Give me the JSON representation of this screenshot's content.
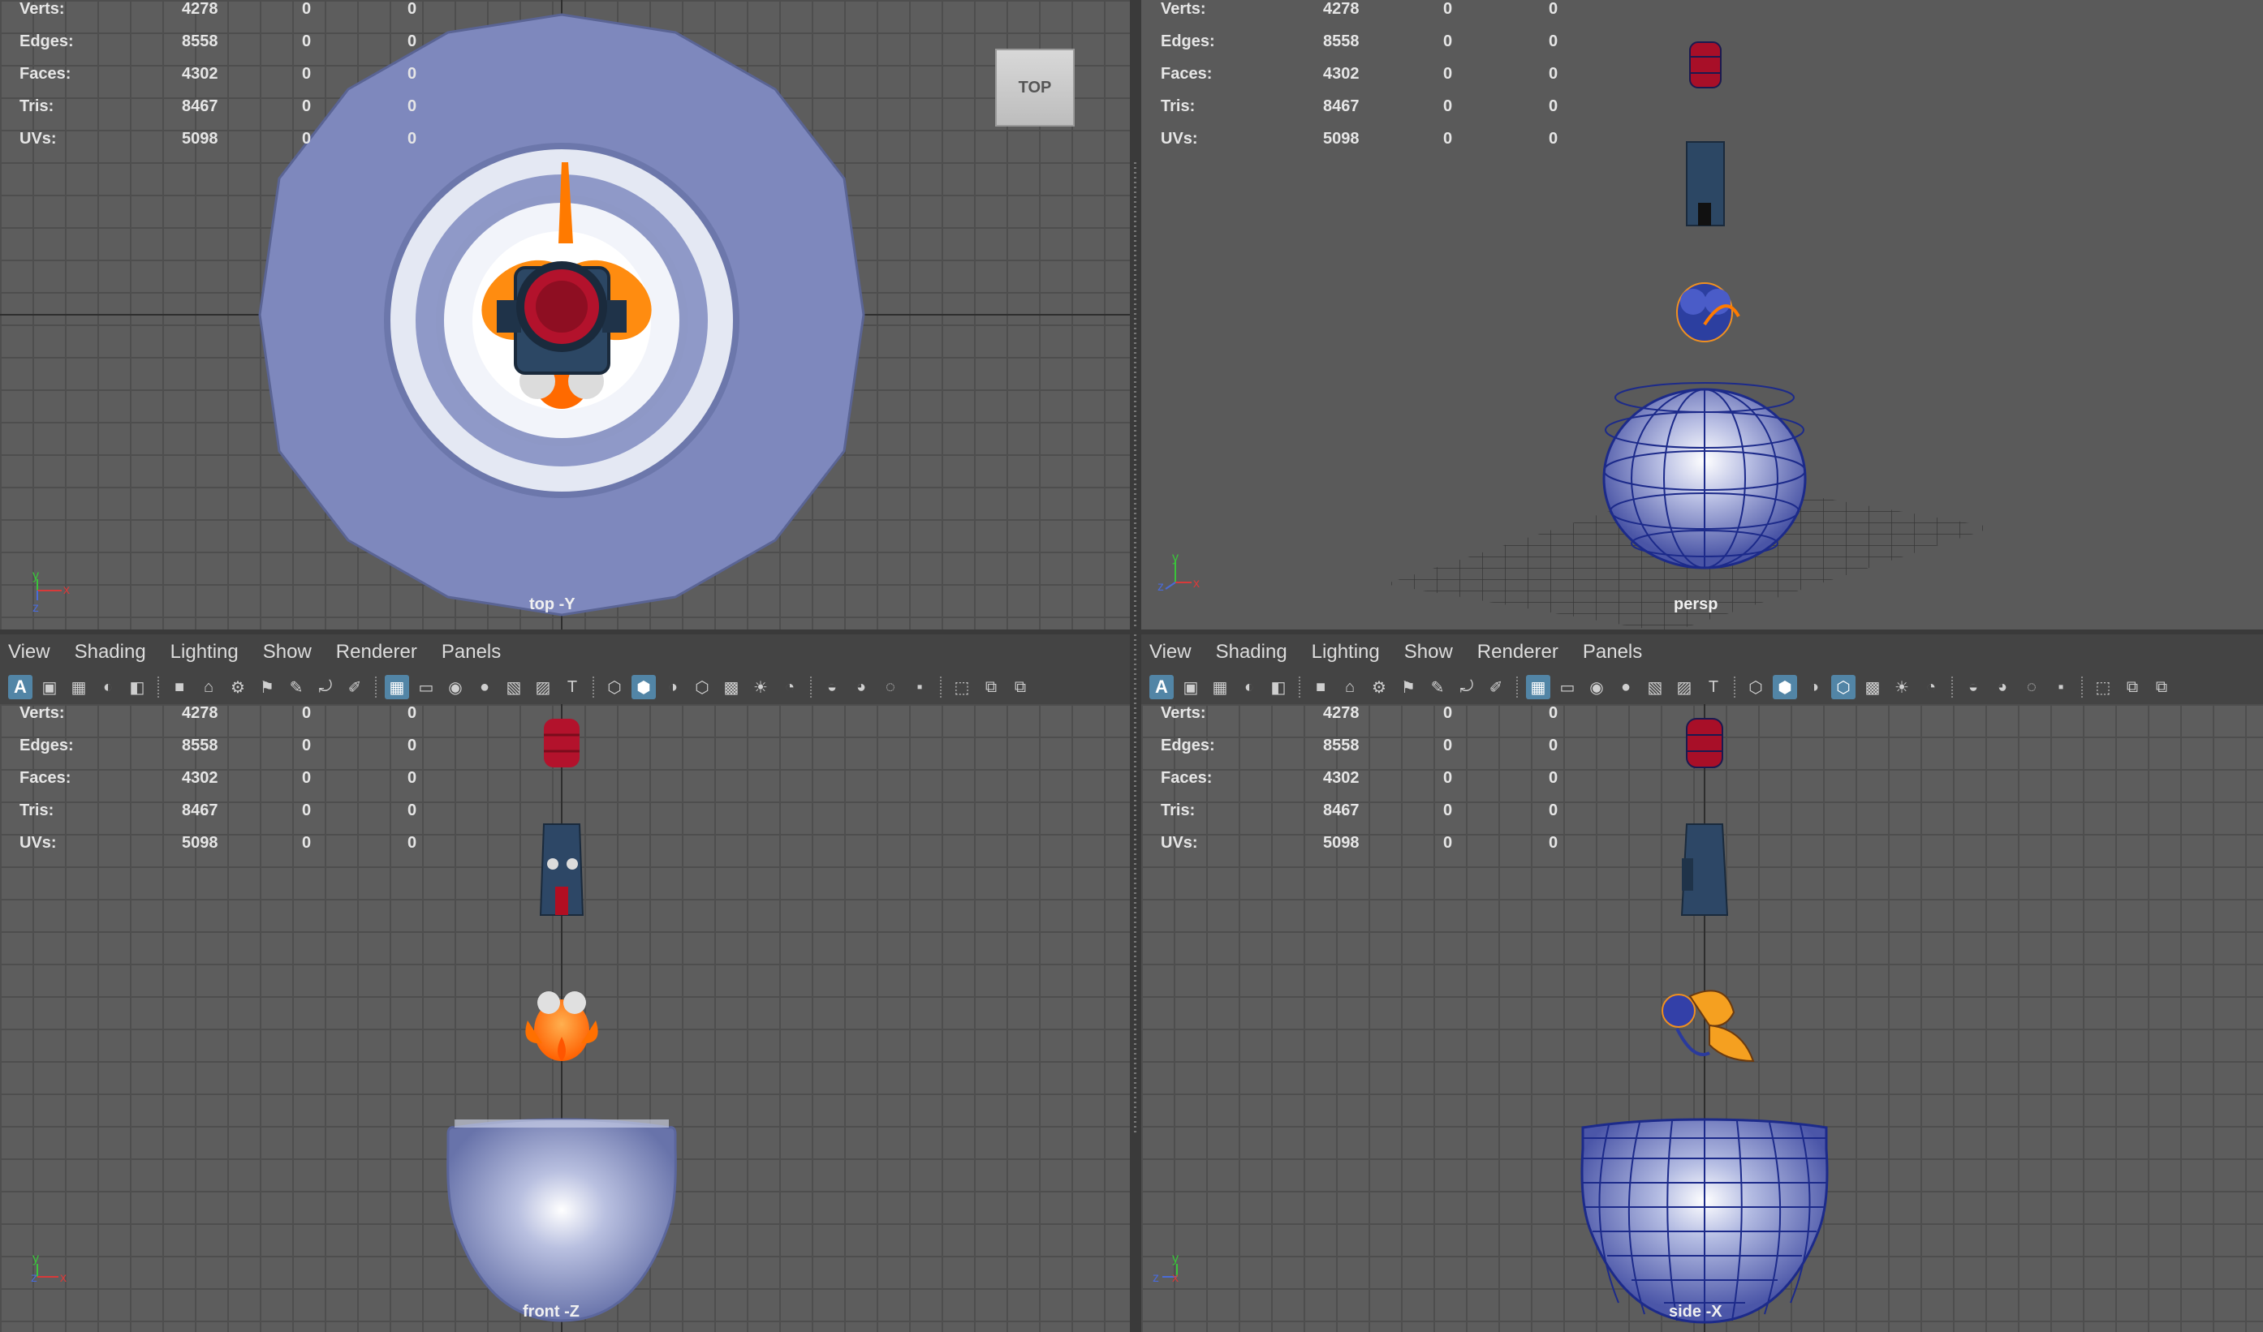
{
  "hud": {
    "rows": [
      {
        "label": "Verts:",
        "v1": "4278",
        "v2": "0",
        "v3": "0"
      },
      {
        "label": "Edges:",
        "v1": "8558",
        "v2": "0",
        "v3": "0"
      },
      {
        "label": "Faces:",
        "v1": "4302",
        "v2": "0",
        "v3": "0"
      },
      {
        "label": "Tris:",
        "v1": "8467",
        "v2": "0",
        "v3": "0"
      },
      {
        "label": "UVs:",
        "v1": "5098",
        "v2": "0",
        "v3": "0"
      }
    ]
  },
  "viewports": {
    "top": {
      "camera": "top -Y",
      "viewcube": "TOP"
    },
    "persp": {
      "camera": "persp"
    },
    "front": {
      "camera": "front -Z"
    },
    "side": {
      "camera": "side -X"
    }
  },
  "panel_menu": {
    "view": "View",
    "shading": "Shading",
    "lighting": "Lighting",
    "show": "Show",
    "renderer": "Renderer",
    "panels": "Panels"
  },
  "toolbar": {
    "a_label": "A"
  },
  "axis": {
    "x": "x",
    "y": "y",
    "z": "z"
  },
  "colors": {
    "accent": "#5285a6",
    "viewport_bg": "#5d5d5d",
    "bowl": "#8b94c4",
    "fish": "#ff7a00",
    "barrel": "#b0122a",
    "tiki": "#2e4a6b"
  }
}
